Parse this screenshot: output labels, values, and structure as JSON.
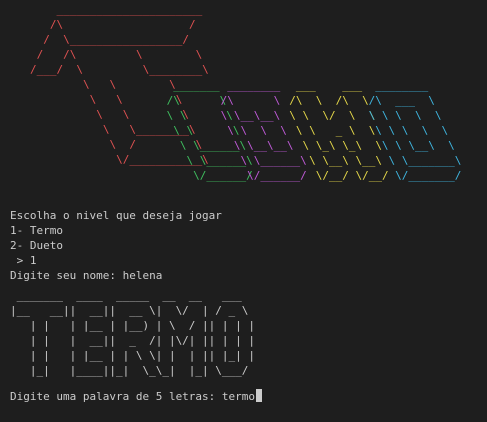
{
  "banner_art": {
    "red": "    ______________________\n   /\\                   /\n  /  \\_________________/\n /   /\\         \\        \\\n/___/  \\         \\________\\\n        \\   \\        \\\n         \\   \\        \\\n          \\   \\        \\\n           \\   \\________\\\n            \\  /         \\\n             \\/___________\\",
    "green": "  _______\n /\\      \\\n \\ \\      \\\n  \\ \\      \\\n   \\ \\______\\\n    \\ \\______\\\n     \\/______/",
    "purple": "  ________\n /\\      \\\n \\ \\__\\__\\\n  \\ \\  \\  \\\n   \\ \\__\\__\\\n    \\ \\______\\\n     \\/______/",
    "yellow": "   ___    ___\n  /\\  \\  /\\  \\\n  \\ \\  \\/  \\  \\\n   \\ \\   _ \\  \\\n    \\ \\_\\ \\_\\  \\\n     \\ \\__\\ \\__\\\n      \\/__/ \\/__/",
    "cyan": "  ________\n /\\  ___  \\\n \\ \\ \\  \\  \\\n  \\ \\ \\  \\  \\\n   \\ \\ \\__\\  \\\n    \\ \\_______\\\n     \\/_______/"
  },
  "colors": {
    "background": "#1e1e1e",
    "text": "#cccccc",
    "red": "#e05252",
    "green": "#3fbf5f",
    "purple": "#c05bd8",
    "yellow": "#e5d84a",
    "cyan": "#3fb6e0"
  },
  "prompt": {
    "question": "Escolha o nivel que deseja jogar",
    "option1": "1- Termo",
    "option2": "2- Dueto",
    "answer": " > 1",
    "name_prompt": "Digite seu nome: helena"
  },
  "termo_art": " _______  ____  _____  __  __   ___\n|__   __||  __||  __ \\|  \\/  | / _ \\\n   | |   | |__ | |__) | \\  / || | | |\n   | |   |  __||  _  /| |\\/| || | | |\n   | |   | |__ | | \\ \\| |  | || |_| |\n   |_|   |____||_|  \\_\\_|  |_| \\___/",
  "input_line": {
    "label": "Digite uma palavra de 5 letras: ",
    "value": "termo"
  }
}
